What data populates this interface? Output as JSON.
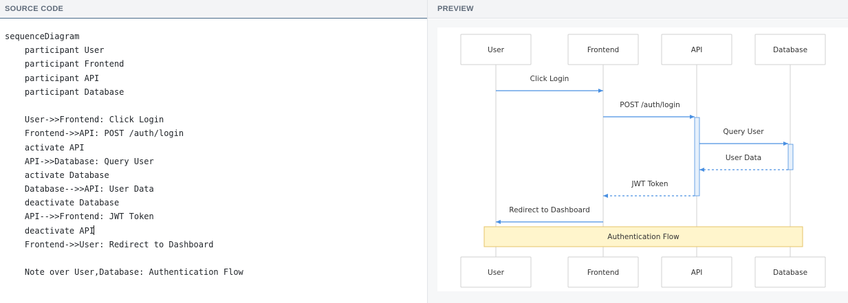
{
  "panes": {
    "source_title": "SOURCE CODE",
    "preview_title": "PREVIEW"
  },
  "code_lines": [
    "sequenceDiagram",
    "    participant User",
    "    participant Frontend",
    "    participant API",
    "    participant Database",
    "",
    "    User->>Frontend: Click Login",
    "    Frontend->>API: POST /auth/login",
    "    activate API",
    "    API->>Database: Query User",
    "    activate Database",
    "    Database-->>API: User Data",
    "    deactivate Database",
    "    API-->>Frontend: JWT Token",
    "    deactivate API",
    "    Frontend->>User: Redirect to Dashboard",
    "",
    "    Note over User,Database: Authentication Flow"
  ],
  "diagram": {
    "participants": [
      "User",
      "Frontend",
      "API",
      "Database"
    ],
    "messages": [
      {
        "from": 0,
        "to": 1,
        "label": "Click Login",
        "style": "solid"
      },
      {
        "from": 1,
        "to": 2,
        "label": "POST /auth/login",
        "style": "solid"
      },
      {
        "from": 2,
        "to": 3,
        "label": "Query User",
        "style": "solid"
      },
      {
        "from": 3,
        "to": 2,
        "label": "User Data",
        "style": "dashed"
      },
      {
        "from": 2,
        "to": 1,
        "label": "JWT Token",
        "style": "dashed"
      },
      {
        "from": 1,
        "to": 0,
        "label": "Redirect to Dashboard",
        "style": "solid"
      }
    ],
    "note": {
      "text": "Authentication Flow",
      "from": 0,
      "to": 3
    },
    "colors": {
      "arrow": "#4a90e2",
      "box_border": "#d0d0d0",
      "lifeline": "#d0d0d0",
      "activation_fill": "#e6f0fb",
      "note_fill": "#fff5cc",
      "note_border": "#e6c36a"
    }
  }
}
